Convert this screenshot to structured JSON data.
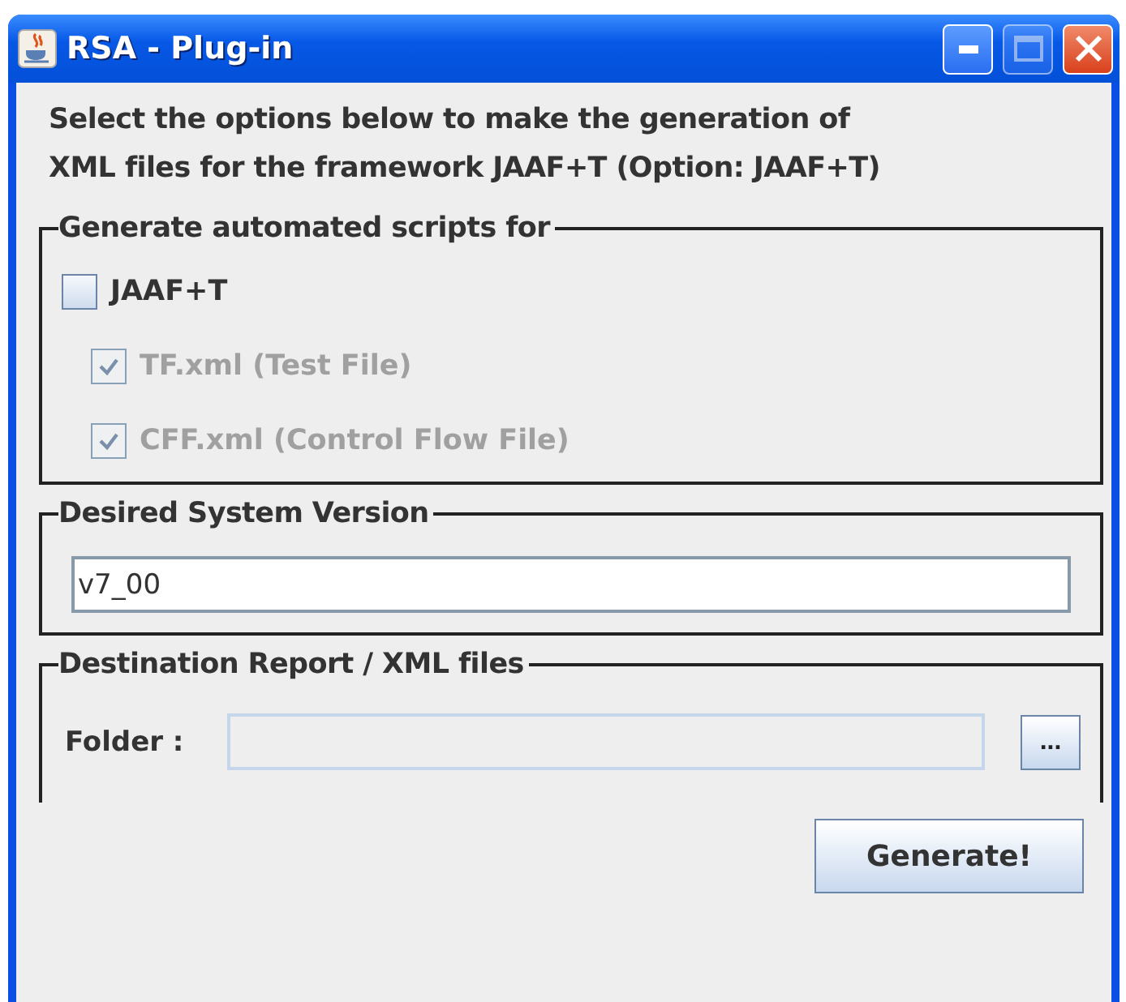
{
  "window": {
    "title": "RSA - Plug-in",
    "controls": [
      {
        "kind": "minimize",
        "disabled": false
      },
      {
        "kind": "maximize",
        "disabled": true
      },
      {
        "kind": "close",
        "disabled": false
      }
    ]
  },
  "intro": [
    "Select the options below to make the generation of",
    "XML files for the framework JAAF+T (Option: JAAF+T)"
  ],
  "scripts_group": {
    "title": "Generate automated scripts for",
    "options": [
      {
        "label": "JAAF+T",
        "checked": false,
        "disabled": false,
        "nested": false
      },
      {
        "label": "TF.xml (Test File)",
        "checked": true,
        "disabled": true,
        "nested": true
      },
      {
        "label": "CFF.xml (Control Flow File)",
        "checked": true,
        "disabled": true,
        "nested": true
      }
    ]
  },
  "version_group": {
    "title": "Desired System Version",
    "value": "v7_00"
  },
  "destination_group": {
    "title": "Destination Report / XML files",
    "label": "Folder :",
    "field_disabled": true,
    "browse_button": "..."
  },
  "buttons": [
    "Generate!"
  ]
}
